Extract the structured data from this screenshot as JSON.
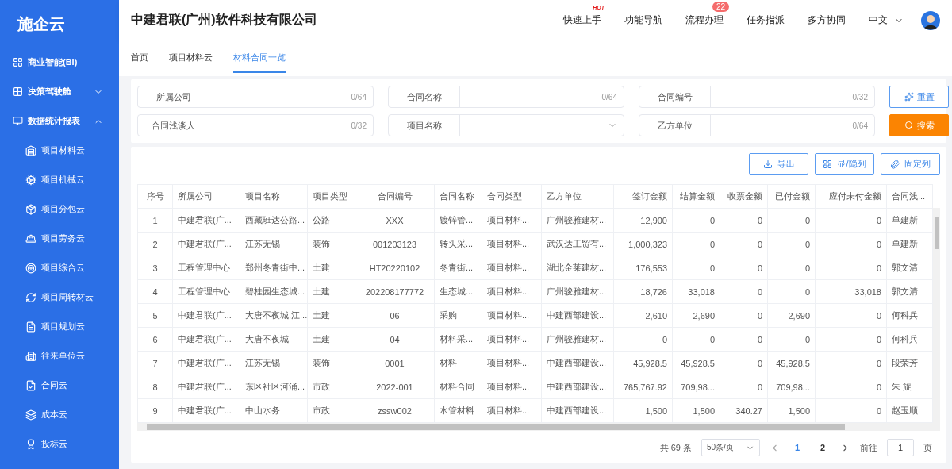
{
  "sidebar": {
    "logo": "施企云",
    "items": [
      {
        "label": "商业智能(BI)"
      },
      {
        "label": "决策驾驶舱",
        "expanded": false
      },
      {
        "label": "数据统计报表",
        "expanded": true,
        "children": [
          {
            "label": "项目材料云"
          },
          {
            "label": "项目机械云"
          },
          {
            "label": "项目分包云"
          },
          {
            "label": "项目劳务云"
          },
          {
            "label": "项目综合云"
          },
          {
            "label": "项目周转材云"
          },
          {
            "label": "项目规划云"
          },
          {
            "label": "往来单位云"
          },
          {
            "label": "合同云"
          },
          {
            "label": "成本云"
          },
          {
            "label": "投标云"
          }
        ]
      }
    ]
  },
  "header": {
    "company": "中建君联(广州)软件科技有限公司",
    "nav": [
      {
        "label": "快速上手",
        "hot": "HOT"
      },
      {
        "label": "功能导航"
      },
      {
        "label": "流程办理",
        "badge": "22"
      },
      {
        "label": "任务指派"
      },
      {
        "label": "多方协同"
      }
    ],
    "language": "中文"
  },
  "tabs": [
    {
      "label": "首页",
      "selected": false
    },
    {
      "label": "项目材料云",
      "selected": false
    },
    {
      "label": "材料合同一览",
      "selected": true
    }
  ],
  "filters": [
    {
      "label": "所属公司",
      "kind": "text",
      "counter": "0/64"
    },
    {
      "label": "合同名称",
      "kind": "text",
      "counter": "0/64"
    },
    {
      "label": "合同编号",
      "kind": "text",
      "counter": "0/32"
    },
    {
      "label": "合同浅谈人",
      "kind": "text",
      "counter": "0/32"
    },
    {
      "label": "项目名称",
      "kind": "select"
    },
    {
      "label": "乙方单位",
      "kind": "text",
      "counter": "0/64"
    }
  ],
  "filter_buttons": [
    {
      "label": "重置",
      "kind": "reset"
    },
    {
      "label": "搜索",
      "kind": "search"
    }
  ],
  "toolbar": [
    {
      "label": "导出"
    },
    {
      "label": "显/隐列"
    },
    {
      "label": "固定列"
    }
  ],
  "table": {
    "columns": [
      "序号",
      "所属公司",
      "项目名称",
      "项目类型",
      "合同编号",
      "合同名称",
      "合同类型",
      "乙方单位",
      "签订金额",
      "结算金额",
      "收票金额",
      "已付金额",
      "应付未付金额",
      "合同浅..."
    ],
    "rows": [
      [
        "1",
        "中建君联(广...",
        "西藏班达公路...",
        "公路",
        "XXX",
        "镀锌管...",
        "项目材料...",
        "广州骏雅建材...",
        "12,900",
        "0",
        "0",
        "0",
        "0",
        "单建新"
      ],
      [
        "2",
        "中建君联(广...",
        "江苏无锡",
        "装饰",
        "001203123",
        "转头采...",
        "项目材料...",
        "武汉达工贸有...",
        "1,000,323",
        "0",
        "0",
        "0",
        "0",
        "单建新"
      ],
      [
        "3",
        "工程管理中心",
        "郑州冬青街中...",
        "土建",
        "HT20220102",
        "冬青街...",
        "项目材料...",
        "湖北金莱建材...",
        "176,553",
        "0",
        "0",
        "0",
        "0",
        "郭文清"
      ],
      [
        "4",
        "工程管理中心",
        "碧桂园生态城...",
        "土建",
        "202208177772",
        "生态城...",
        "项目材料...",
        "广州骏雅建材...",
        "18,726",
        "33,018",
        "0",
        "0",
        "33,018",
        "郭文清"
      ],
      [
        "5",
        "中建君联(广...",
        "大唐不夜城,江...",
        "土建",
        "06",
        "采购",
        "项目材料...",
        "中建西部建设...",
        "2,610",
        "2,690",
        "0",
        "2,690",
        "0",
        "何科兵"
      ],
      [
        "6",
        "中建君联(广...",
        "大唐不夜城",
        "土建",
        "04",
        "材料采...",
        "项目材料...",
        "广州骏雅建材...",
        "0",
        "0",
        "0",
        "0",
        "0",
        "何科兵"
      ],
      [
        "7",
        "中建君联(广...",
        "江苏无锡",
        "装饰",
        "0001",
        "材料",
        "项目材料...",
        "中建西部建设...",
        "45,928.5",
        "45,928.5",
        "0",
        "45,928.5",
        "0",
        "段荣芳"
      ],
      [
        "8",
        "中建君联(广...",
        "东区社区河涌...",
        "市政",
        "2022-001",
        "材料合同",
        "项目材料...",
        "中建西部建设...",
        "765,767.92",
        "709,98...",
        "0",
        "709,98...",
        "0",
        "朱 旋"
      ],
      [
        "9",
        "中建君联(广...",
        "中山水务",
        "市政",
        "zssw002",
        "水管材料",
        "项目材料...",
        "中建西部建设...",
        "1,500",
        "1,500",
        "340.27",
        "1,500",
        "0",
        "赵玉顺"
      ]
    ]
  },
  "pagination": {
    "total": "共 69 条",
    "page_size": "50条/页",
    "pages": [
      {
        "label": "1",
        "selected": true
      },
      {
        "label": "2",
        "selected": false
      }
    ],
    "goto_label": "前往",
    "goto_value": "1",
    "goto_suffix": "页"
  }
}
